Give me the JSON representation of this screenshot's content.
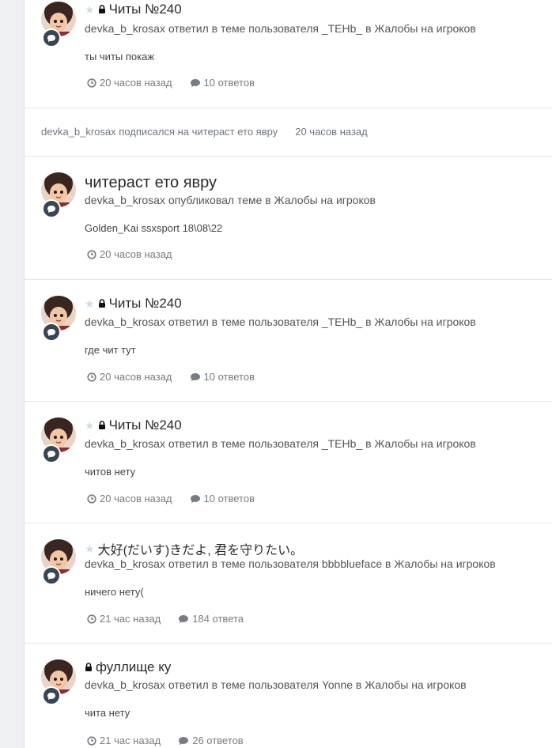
{
  "feed": {
    "items": [
      {
        "kind": "reply",
        "title": "Читы №240",
        "has_star": true,
        "has_lock": true,
        "meta": "devka_b_krosax ответил в теме пользователя _TEHb_ в Жалобы на игроков",
        "snippet": "ты читы покаж",
        "time": "20 часов назад",
        "replies": "10 ответов"
      },
      {
        "kind": "follow",
        "text": "devka_b_krosax подписался на читераст ето явру",
        "time": "20 часов назад"
      },
      {
        "kind": "topic",
        "title": "читераст ето явру",
        "has_star": false,
        "has_lock": false,
        "meta": "devka_b_krosax опубликовал теме в Жалобы на игроков",
        "snippet": "Golden_Kai ssxsport 18\\08\\22",
        "time": "20 часов назад"
      },
      {
        "kind": "reply",
        "title": "Читы №240",
        "has_star": true,
        "has_lock": true,
        "meta": "devka_b_krosax ответил в теме пользователя _TEHb_ в Жалобы на игроков",
        "snippet": "где чит тут",
        "time": "20 часов назад",
        "replies": "10 ответов"
      },
      {
        "kind": "reply",
        "title": "Читы №240",
        "has_star": true,
        "has_lock": true,
        "meta": "devka_b_krosax ответил в теме пользователя _TEHb_ в Жалобы на игроков",
        "snippet": "читов нету",
        "time": "20 часов назад",
        "replies": "10 ответов"
      },
      {
        "kind": "reply",
        "title": "大好(だいす)きだよ, 君を守りたい。",
        "has_star": true,
        "has_lock": false,
        "meta": "devka_b_krosax ответил в теме пользователя bbbblueface в Жалобы на игроков",
        "snippet": "ничего нету(",
        "time": "21 час назад",
        "replies": "184 ответа"
      },
      {
        "kind": "reply",
        "title": "фуллище ку",
        "has_star": false,
        "has_lock": true,
        "meta": "devka_b_krosax ответил в теме пользователя Yonne в Жалобы на игроков",
        "snippet": "чита нету",
        "time": "21 час назад",
        "replies": "26 ответов"
      }
    ]
  },
  "icons": {
    "star": "star-icon",
    "lock": "lock-icon",
    "clock": "clock-icon",
    "comment": "comment-icon"
  },
  "colors": {
    "badge": "#384557",
    "star": "#c9dbee",
    "muted": "#767b84"
  }
}
